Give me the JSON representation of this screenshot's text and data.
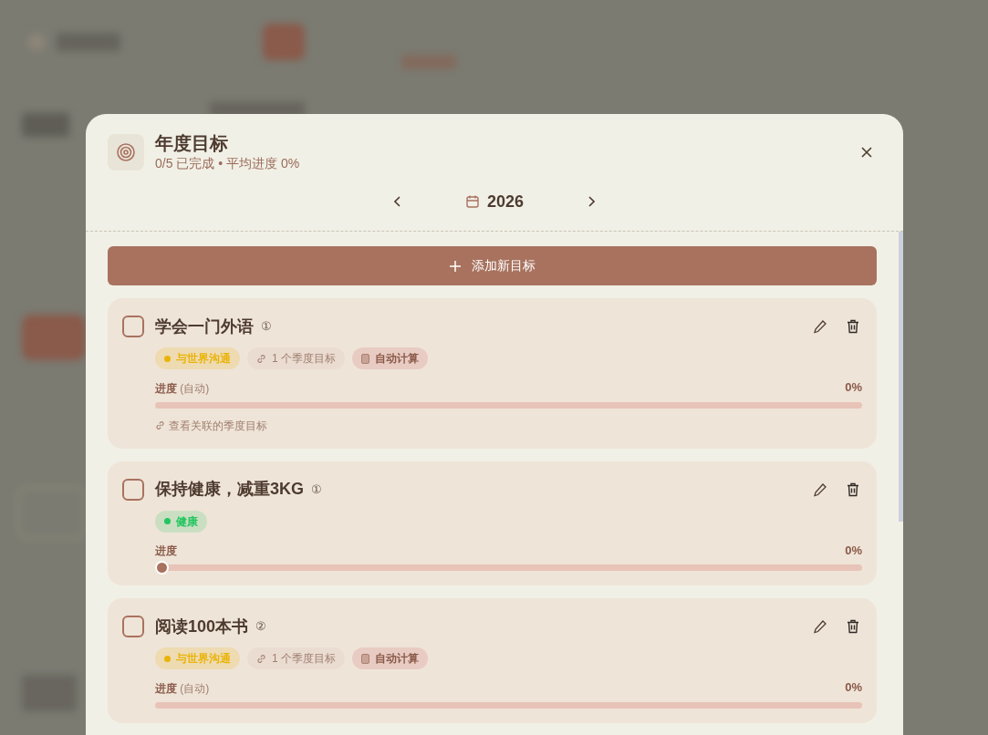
{
  "dialog": {
    "title": "年度目标",
    "summary": "0/5 已完成 • 平均进度 0%",
    "year": "2026",
    "add_button": "添加新目标"
  },
  "goals": [
    {
      "title": "学会一门外语",
      "badge": "①",
      "checked": false,
      "tags": [
        {
          "kind": "category",
          "label": "与世界沟通",
          "color": "#eab308"
        },
        {
          "kind": "link",
          "label": "1 个季度目标"
        },
        {
          "kind": "auto",
          "label": "自动计算"
        }
      ],
      "progress": {
        "kind": "auto",
        "label": "进度",
        "note": "(自动)",
        "reading": "0%",
        "level": 0
      },
      "link": "查看关联的季度目标"
    },
    {
      "title": "保持健康，减重3KG",
      "badge": "①",
      "checked": false,
      "tags": [
        {
          "kind": "category",
          "label": "健康",
          "color": "#22c55e"
        }
      ],
      "progress": {
        "kind": "manual",
        "label": "进度",
        "reading": "0%",
        "level": 0
      }
    },
    {
      "title": "阅读100本书",
      "badge": "②",
      "checked": false,
      "tags": [
        {
          "kind": "category",
          "label": "与世界沟通",
          "color": "#eab308"
        },
        {
          "kind": "link",
          "label": "1 个季度目标"
        },
        {
          "kind": "auto",
          "label": "自动计算"
        }
      ],
      "progress": {
        "kind": "auto",
        "label": "进度",
        "note": "(自动)",
        "reading": "0%",
        "level": 0
      }
    }
  ]
}
